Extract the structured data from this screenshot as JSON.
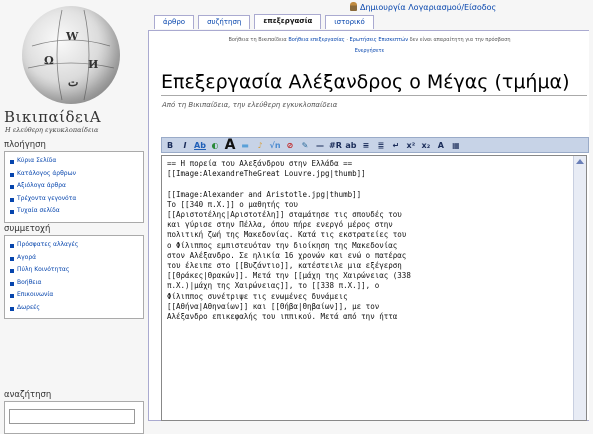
{
  "logo": {
    "title": "ΒικιπαίδειΑ",
    "subtitle": "Η ελεύθερη εγκυκλοπαίδεια"
  },
  "personal": {
    "login_label": "Δημιουργία Λογαριασμού/Είσοδος"
  },
  "tabs": [
    {
      "label": "άρθρο",
      "selected": false
    },
    {
      "label": "συζήτηση",
      "selected": false
    },
    {
      "label": "επεξεργασία",
      "selected": true
    },
    {
      "label": "ιστορικό",
      "selected": false
    }
  ],
  "notice": {
    "line1_prefix": "Βοήθεια τη Βικιπαίδεια",
    "line1_link1": "Βοήθεια επεξεργασίας",
    "line1_link2": "Ερωτήσεις Επισκεπτών",
    "line1_suffix": "δεν είναι απαραίτητη για την πρόσβαση",
    "line2_link": "Ενεργήσετε"
  },
  "heading": "Επεξεργασία Αλέξανδρος ο Μέγας (τμήμα)",
  "sitesub": "Από τη Βικιπαίδεια, την ελεύθερη εγκυκλοπαίδεια",
  "sidebar": {
    "navigation": {
      "title": "πλοήγηση",
      "items": [
        "Κύρια Σελίδα",
        "Κατάλογος άρθρων",
        "Αξιόλογα άρθρα",
        "Τρέχοντα γεγονότα",
        "Τυχαία σελίδα"
      ]
    },
    "community": {
      "title": "συμμετοχή",
      "items": [
        "Πρόσφατες αλλαγές",
        "Αγορά",
        "Πύλη Κοινότητας",
        "Βοήθεια",
        "Επικοινωνία",
        "Δωρεές"
      ]
    },
    "search": {
      "title": "αναζήτηση",
      "value": ""
    }
  },
  "editor": {
    "text": "== Η πορεία του Αλεξάνδρου στην Ελλάδα ==\n[[Image:AlexandreTheGreat Louvre.jpg|thumb]]\n\n[[Image:Alexander and Aristotle.jpg|thumb]]\nΤο [[340 π.Χ.]] ο μαθητής του\n[[Αριστοτέλης|Αριστοτέλη]] σταμάτησε τις σπουδές του\nκαι γύρισε στην Πέλλα, όπου πήρε ενεργό μέρος στην\nπολιτική ζωή της Μακεδονίας. Κατά τις εκστρατείες του\nο Φίλιππος εμπιστευόταν την διοίκηση της Μακεδονίας\nστον Αλέξανδρο. Σε ηλικία 16 χρονών και ενώ ο πατέρας\nτου έλειπε στο [[Βυζάντιο]], κατέστειλε μια εξέγερση\n[[Θράκες|Θρακών]]. Μετά την [[μάχη της Χαιρώνειας (338\nπ.Χ.)|μάχη της Χαιρώνειας]], το [[338 π.Χ.]], ο\nΦίλιππος συνέτριψε τις ενωμένες δυνάμεις\n[[Αθήνα|Αθηναίων]] και [[Θήβα|Θηβαίων]], με τον\nΑλέξανδρο επικεφαλής του ιππικού. Μετά από την ήττα"
  },
  "colors": {
    "link": "#0645ad",
    "toolbar_bg": "#c7d3e7"
  },
  "toolbar": [
    {
      "name": "bold-button",
      "label": "B",
      "color": "#1b2d5a"
    },
    {
      "name": "italic-button",
      "label": "I",
      "color": "#1b2d5a"
    },
    {
      "name": "internal-link-button",
      "label": "Ab",
      "color": "#1f5fb8"
    },
    {
      "name": "external-link-button",
      "label": "◐",
      "color": "#2a8a3a"
    },
    {
      "name": "headline-button",
      "label": "A",
      "color": "#111111"
    },
    {
      "name": "image-button",
      "label": "▬",
      "color": "#5aa0d8"
    },
    {
      "name": "media-button",
      "label": "♪",
      "color": "#d8a040"
    },
    {
      "name": "math-button",
      "label": "√n",
      "color": "#4a8ad0"
    },
    {
      "name": "nowiki-button",
      "label": "⊘",
      "color": "#c02020"
    },
    {
      "name": "signature-button",
      "label": "✎",
      "color": "#2a6a9a"
    },
    {
      "name": "hr-button",
      "label": "—",
      "color": "#1b2d5a"
    },
    {
      "name": "redirect-button",
      "label": "#R",
      "color": "#1b2d5a"
    },
    {
      "name": "strike-button",
      "label": "ab",
      "color": "#1b2d5a"
    },
    {
      "name": "list-button",
      "label": "≡",
      "color": "#1b2d5a"
    },
    {
      "name": "numbered-list-button",
      "label": "≣",
      "color": "#1b2d5a"
    },
    {
      "name": "linebreak-button",
      "label": "↵",
      "color": "#1b2d5a"
    },
    {
      "name": "superscript-button",
      "label": "x²",
      "color": "#1b2d5a"
    },
    {
      "name": "subscript-button",
      "label": "x₂",
      "color": "#1b2d5a"
    },
    {
      "name": "small-button",
      "label": "A",
      "color": "#1b2d5a"
    },
    {
      "name": "table-button",
      "label": "▦",
      "color": "#1b2d5a"
    }
  ]
}
